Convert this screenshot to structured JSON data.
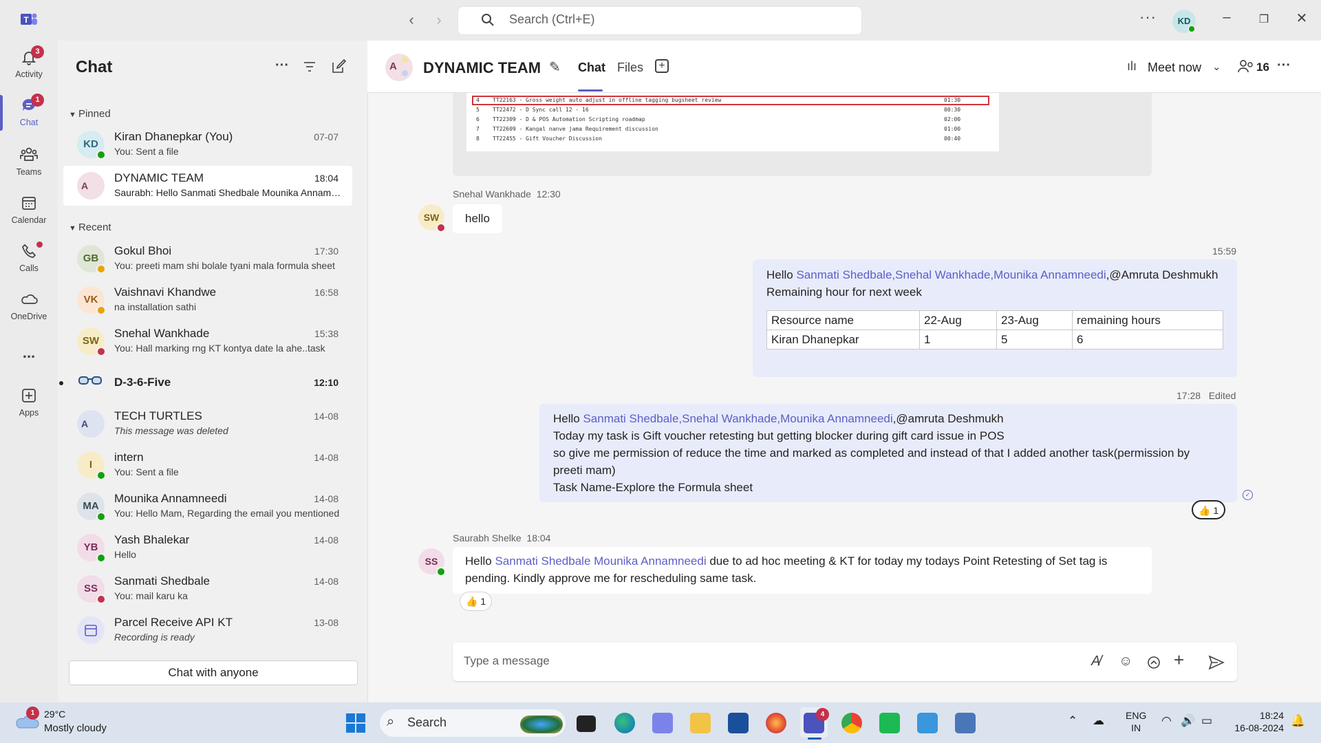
{
  "titlebar": {
    "search_placeholder": "Search (Ctrl+E)",
    "avatar_initials": "KD"
  },
  "rail": {
    "items": [
      {
        "label": "Activity",
        "badge": "3"
      },
      {
        "label": "Chat",
        "badge": "1"
      },
      {
        "label": "Teams"
      },
      {
        "label": "Calendar"
      },
      {
        "label": "Calls"
      },
      {
        "label": "OneDrive"
      },
      {
        "label": "..."
      },
      {
        "label": "Apps"
      }
    ]
  },
  "chatlist": {
    "title": "Chat",
    "pinned_label": "Pinned",
    "recent_label": "Recent",
    "chat_with_anyone": "Chat with anyone",
    "pinned": [
      {
        "initials": "KD",
        "name": "Kiran Dhanepkar (You)",
        "time": "07-07",
        "preview": "You: Sent a file"
      },
      {
        "initials": "A",
        "name": "DYNAMIC TEAM",
        "time": "18:04",
        "preview": "Saurabh: Hello Sanmati Shedbale Mounika Annamneedi"
      }
    ],
    "recent": [
      {
        "initials": "GB",
        "name": "Gokul Bhoi",
        "time": "17:30",
        "preview": "You: preeti mam shi bolale tyani mala formula sheet"
      },
      {
        "initials": "VK",
        "name": "Vaishnavi Khandwe",
        "time": "16:58",
        "preview": "na installation sathi"
      },
      {
        "initials": "SW",
        "name": "Snehal Wankhade",
        "time": "15:38",
        "preview": "You: Hall marking rng KT kontya date la ahe..task"
      },
      {
        "initials": "",
        "name": "D-3-6-Five",
        "time": "12:10",
        "preview": ""
      },
      {
        "initials": "A",
        "name": "TECH TURTLES",
        "time": "14-08",
        "preview": "This message was deleted"
      },
      {
        "initials": "I",
        "name": "intern",
        "time": "14-08",
        "preview": "You: Sent a file"
      },
      {
        "initials": "MA",
        "name": "Mounika Annamneedi",
        "time": "14-08",
        "preview": "You: Hello Mam, Regarding the email you mentioned"
      },
      {
        "initials": "YB",
        "name": "Yash Bhalekar",
        "time": "14-08",
        "preview": "Hello"
      },
      {
        "initials": "SS",
        "name": "Sanmati Shedbale",
        "time": "14-08",
        "preview": "You: mail karu ka"
      },
      {
        "initials": "",
        "name": "Parcel Receive API KT",
        "time": "13-08",
        "preview": "Recording is ready"
      }
    ]
  },
  "header": {
    "title": "DYNAMIC TEAM",
    "tab_chat": "Chat",
    "tab_files": "Files",
    "meet_now": "Meet now",
    "participants": "16"
  },
  "image_rows": [
    {
      "n": "4",
      "code": "TT22163 - Gross weight auto adjust in offline tagging bugsheet review",
      "time": "01:30"
    },
    {
      "n": "5",
      "code": "TT22472 - D Sync call 12 - 16",
      "time": "00:30"
    },
    {
      "n": "6",
      "code": "TT22309 - D & POS Automation Scripting roadmap",
      "time": "02:00"
    },
    {
      "n": "7",
      "code": "TT22609 - Kangal nanve jama Requirement discussion",
      "time": "01:00"
    },
    {
      "n": "8",
      "code": "TT22455 - Gift Voucher Discussion",
      "time": "00:40"
    }
  ],
  "messages": {
    "m1": {
      "sender": "Snehal Wankhade",
      "time": "12:30",
      "initials": "SW",
      "text": "hello"
    },
    "m2": {
      "time": "15:59",
      "hello": "Hello ",
      "mentions": "Sanmati Shedbale,Snehal Wankhade,Mounika Annamneedi",
      "after_mention": ",@Amruta Deshmukh",
      "line2": "Remaining hour for next week",
      "table": {
        "headers": [
          "Resource name",
          "22-Aug",
          "23-Aug",
          "remaining hours"
        ],
        "rows": [
          [
            "Kiran Dhanepkar",
            "1",
            "5",
            "6"
          ]
        ]
      }
    },
    "m3": {
      "time": "17:28",
      "edited": "Edited",
      "hello": "Hello ",
      "mentions": "Sanmati Shedbale,Snehal Wankhade,Mounika Annamneedi",
      "after_mention": ",@amruta Deshmukh",
      "line2": "Today my task is Gift voucher retesting but getting blocker during gift card issue in POS",
      "line3": "so give me permission of reduce the time and marked as completed and instead of that I added another task(permission by",
      "line4": "preeti mam)",
      "line5": "Task Name-Explore the Formula sheet",
      "reaction": "👍",
      "reaction_count": "1"
    },
    "m4": {
      "sender": "Saurabh Shelke",
      "time": "18:04",
      "initials": "SS",
      "hello": "Hello ",
      "mentions": "Sanmati Shedbale Mounika Annamneedi",
      "line1_rest": " due to ad hoc meeting & KT  for today my todays Point Retesting  of Set tag is",
      "line2": "pending. Kindly approve me for rescheduling same  task.",
      "reaction": "👍",
      "reaction_count": "1"
    }
  },
  "compose": {
    "placeholder": "Type a message"
  },
  "taskbar": {
    "weather_badge": "1",
    "temperature": "29°C",
    "weather": "Mostly cloudy",
    "search": "Search",
    "teams_badge": "4",
    "lang1": "ENG",
    "lang2": "IN",
    "time": "18:24",
    "date": "16-08-2024"
  },
  "colors": {
    "accent": "#5b5fc7",
    "online": "#13a10e",
    "busy": "#c4314b",
    "away": "#eaa300"
  }
}
